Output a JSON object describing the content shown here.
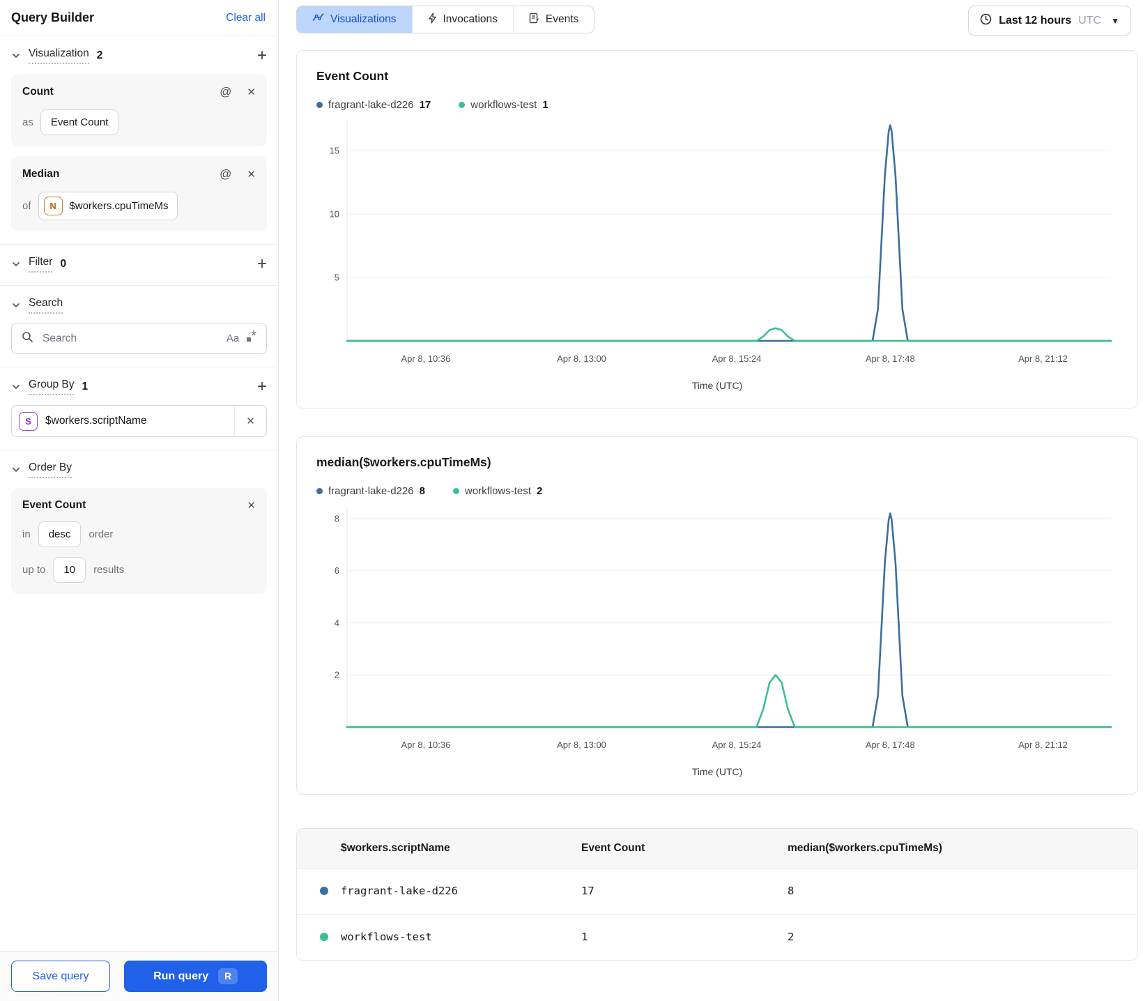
{
  "sidebar": {
    "title": "Query Builder",
    "clear_all": "Clear all",
    "visualization": {
      "label": "Visualization",
      "count": "2"
    },
    "count_card": {
      "title": "Count",
      "as_label": "as",
      "alias": "Event Count"
    },
    "median_card": {
      "title": "Median",
      "of_label": "of",
      "badge": "N",
      "field": "$workers.cpuTimeMs"
    },
    "filter": {
      "label": "Filter",
      "count": "0"
    },
    "search": {
      "label": "Search",
      "placeholder": "Search",
      "case_icon": "Aa"
    },
    "group_by": {
      "label": "Group By",
      "count": "1",
      "badge": "S",
      "field": "$workers.scriptName"
    },
    "order_by": {
      "label": "Order By",
      "card": {
        "title": "Event Count",
        "in_label": "in",
        "direction": "desc",
        "order_label": "order",
        "up_to_label": "up to",
        "limit": "10",
        "results_label": "results"
      }
    },
    "footer": {
      "save": "Save query",
      "run": "Run query",
      "run_shortcut": "R"
    }
  },
  "toolbar": {
    "tabs": [
      {
        "label": "Visualizations"
      },
      {
        "label": "Invocations"
      },
      {
        "label": "Events"
      }
    ],
    "time_range": {
      "label": "Last 12 hours",
      "timezone": "UTC"
    }
  },
  "chart_data": [
    {
      "type": "line",
      "title": "Event Count",
      "xlabel": "Time (UTC)",
      "x_ticks": [
        "Apr 8, 10:36",
        "Apr 8, 13:00",
        "Apr 8, 15:24",
        "Apr 8, 17:48",
        "Apr 8, 21:12"
      ],
      "x_tick_positions": [
        0.103,
        0.307,
        0.51,
        0.711,
        0.911
      ],
      "y_ticks": [
        5,
        10,
        15
      ],
      "ylim": [
        0,
        17.25
      ],
      "grid": true,
      "legend": [
        {
          "name": "fragrant-lake-d226",
          "value": "17",
          "color": "#3c6e9f"
        },
        {
          "name": "workflows-test",
          "value": "1",
          "color": "#3dbf8d"
        }
      ],
      "series": [
        {
          "name": "fragrant-lake-d226",
          "color": "#3c6e9f",
          "points": [
            [
              0,
              0
            ],
            [
              0.688,
              0
            ],
            [
              0.695,
              2.5
            ],
            [
              0.704,
              13
            ],
            [
              0.709,
              16.5
            ],
            [
              0.711,
              17
            ],
            [
              0.713,
              16.5
            ],
            [
              0.718,
              13
            ],
            [
              0.727,
              2.5
            ],
            [
              0.734,
              0
            ],
            [
              1,
              0
            ]
          ]
        },
        {
          "name": "workflows-test",
          "color": "#3dbf8d",
          "points": [
            [
              0,
              0
            ],
            [
              0.536,
              0
            ],
            [
              0.545,
              0.35
            ],
            [
              0.553,
              0.85
            ],
            [
              0.561,
              1
            ],
            [
              0.569,
              0.85
            ],
            [
              0.577,
              0.35
            ],
            [
              0.586,
              0
            ],
            [
              1,
              0
            ]
          ]
        }
      ]
    },
    {
      "type": "line",
      "title": "median($workers.cpuTimeMs)",
      "xlabel": "Time (UTC)",
      "x_ticks": [
        "Apr 8, 10:36",
        "Apr 8, 13:00",
        "Apr 8, 15:24",
        "Apr 8, 17:48",
        "Apr 8, 21:12"
      ],
      "x_tick_positions": [
        0.103,
        0.307,
        0.51,
        0.711,
        0.911
      ],
      "y_ticks": [
        2,
        4,
        6,
        8
      ],
      "ylim": [
        0,
        8.4
      ],
      "grid": true,
      "legend": [
        {
          "name": "fragrant-lake-d226",
          "value": "8",
          "color": "#3c6e9f"
        },
        {
          "name": "workflows-test",
          "value": "2",
          "color": "#3dbf8d"
        }
      ],
      "series": [
        {
          "name": "fragrant-lake-d226",
          "color": "#3c6e9f",
          "points": [
            [
              0,
              0
            ],
            [
              0.688,
              0
            ],
            [
              0.695,
              1.2
            ],
            [
              0.704,
              6.3
            ],
            [
              0.709,
              7.95
            ],
            [
              0.711,
              8.2
            ],
            [
              0.713,
              7.95
            ],
            [
              0.718,
              6.3
            ],
            [
              0.727,
              1.2
            ],
            [
              0.734,
              0
            ],
            [
              1,
              0
            ]
          ]
        },
        {
          "name": "workflows-test",
          "color": "#3dbf8d",
          "points": [
            [
              0,
              0
            ],
            [
              0.536,
              0
            ],
            [
              0.545,
              0.7
            ],
            [
              0.553,
              1.7
            ],
            [
              0.561,
              2
            ],
            [
              0.569,
              1.7
            ],
            [
              0.577,
              0.7
            ],
            [
              0.586,
              0
            ],
            [
              1,
              0
            ]
          ]
        }
      ]
    }
  ],
  "table": {
    "columns": [
      "$workers.scriptName",
      "Event Count",
      "median($workers.cpuTimeMs)"
    ],
    "rows": [
      {
        "color": "#3c6e9f",
        "script": "fragrant-lake-d226",
        "event_count": "17",
        "median": "8"
      },
      {
        "color": "#3dbf8d",
        "script": "workflows-test",
        "event_count": "1",
        "median": "2"
      }
    ]
  },
  "colors": {
    "accent_blue": "#2160e8",
    "active_tab_bg": "#bcd7fb",
    "series_blue": "#3c6e9f",
    "series_green": "#3dbf8d"
  }
}
